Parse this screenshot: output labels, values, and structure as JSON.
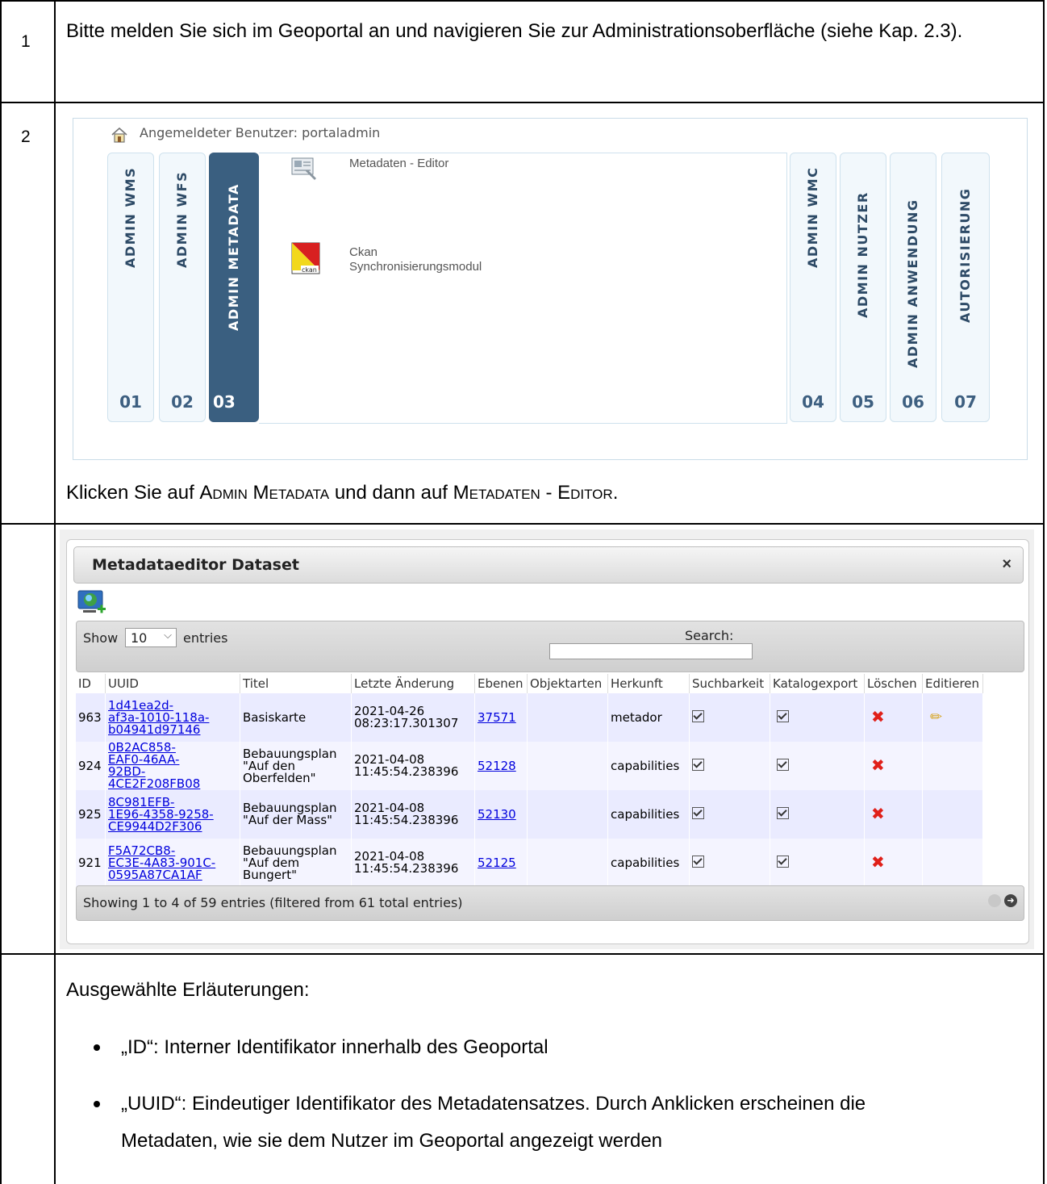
{
  "rows": [
    {
      "step": "1",
      "text": "Bitte melden Sie sich im Geoportal an und navigieren Sie zur Administrationsoberfläche (siehe Kap. 2.3)."
    },
    {
      "step": "2",
      "caption": "Klicken Sie auf ADMIN METADATA und dann auf METADATEN - EDITOR."
    }
  ],
  "caption_parts": {
    "p1": "Klicken Sie auf ",
    "admin_metadata": "Admin Metadata",
    "p2": " und dann auf ",
    "metadaten_editor": "Metadaten - Editor",
    "p3": "."
  },
  "admin_panel": {
    "user_label": "Angemeldeter Benutzer: portaladmin",
    "tabs": [
      {
        "label": "ADMIN WMS",
        "number": "01"
      },
      {
        "label": "ADMIN WFS",
        "number": "02"
      },
      {
        "label": "ADMIN METADATA",
        "number": "03",
        "active": true
      },
      {
        "label": "ADMIN WMC",
        "number": "04"
      },
      {
        "label": "ADMIN NUTZER",
        "number": "05"
      },
      {
        "label": "ADMIN ANWENDUNG",
        "number": "06"
      },
      {
        "label": "AUTORISIERUNG",
        "number": "07"
      }
    ],
    "menu": [
      {
        "label": "Metadaten - Editor",
        "icon": "metadata-editor-icon"
      },
      {
        "label_line1": "Ckan",
        "label_line2": "Synchronisierungsmodul",
        "icon": "ckan-icon",
        "icon_text": "ckan"
      }
    ]
  },
  "dialog": {
    "title": "Metadataeditor Dataset",
    "close": "×",
    "show_label": "Show",
    "entries_value": "10",
    "entries_label": "entries",
    "search_label": "Search:",
    "search_value": "",
    "columns": [
      "ID",
      "UUID",
      "Titel",
      "Letzte Änderung",
      "Ebenen",
      "Objektarten",
      "Herkunft",
      "Suchbarkeit",
      "Katalogexport",
      "Löschen",
      "Editieren"
    ],
    "records": [
      {
        "id": "963",
        "uuid": [
          "1d41ea2d-",
          "af3a-1010-118a-",
          "b04941d97146"
        ],
        "title": [
          "Basiskarte"
        ],
        "date": "2021-04-26",
        "time": "08:23:17.301307",
        "ebenen": "37571",
        "herkunft": "metador",
        "edit": true
      },
      {
        "id": "924",
        "uuid": [
          "0B2AC858-",
          "EAF0-46AA-",
          "92BD-4CE2F208FB08"
        ],
        "title": [
          "Bebauungsplan",
          "\"Auf den",
          "Oberfelden\""
        ],
        "date": "2021-04-08",
        "time": "11:45:54.238396",
        "ebenen": "52128",
        "herkunft": "capabilities",
        "edit": false
      },
      {
        "id": "925",
        "uuid": [
          "8C981EFB-",
          "1E96-4358-9258-",
          "CE9944D2F306"
        ],
        "title": [
          "Bebauungsplan",
          "\"Auf der Mass\""
        ],
        "date": "2021-04-08",
        "time": "11:45:54.238396",
        "ebenen": "52130",
        "herkunft": "capabilities",
        "edit": false
      },
      {
        "id": "921",
        "uuid": [
          "F5A72CB8-",
          "EC3E-4A83-901C-",
          "0595A87CA1AF"
        ],
        "title": [
          "Bebauungsplan",
          "\"Auf dem",
          "Bungert\""
        ],
        "date": "2021-04-08",
        "time": "11:45:54.238396",
        "ebenen": "52125",
        "herkunft": "capabilities",
        "edit": false
      }
    ],
    "footer_text": "Showing 1 to 4 of 59 entries (filtered from 61 total entries)"
  },
  "explanations": {
    "heading": "Ausgewählte Erläuterungen:",
    "items": [
      "„ID“: Interner Identifikator innerhalb des Geoportal",
      "„UUID“: Eindeutiger Identifikator des Metadatensatzes. Durch Anklicken erscheinen die",
      "Metadaten, wie sie dem Nutzer im Geoportal angezeigt werden"
    ]
  }
}
